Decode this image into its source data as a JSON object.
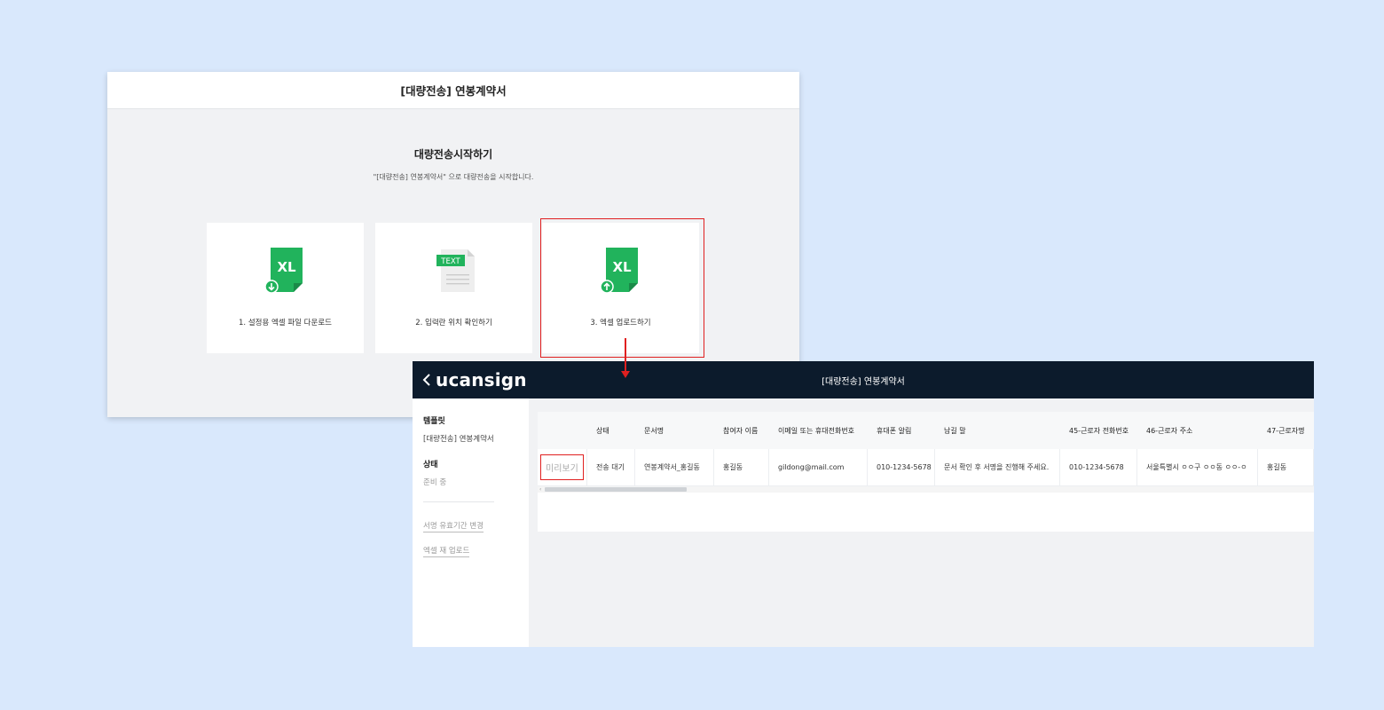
{
  "window1": {
    "title": "[대량전송] 연봉계약서",
    "heading": "대량전송시작하기",
    "subtitle": "\"[대량전송] 연봉계약서\" 으로 대량전송을 시작합니다.",
    "cards": [
      {
        "label": "1. 설정용 엑셀 파일 다운로드",
        "icon": "excel-download-icon",
        "badge": "XL"
      },
      {
        "label": "2. 입력란 위치 확인하기",
        "icon": "text-file-icon",
        "badge": "TEXT"
      },
      {
        "label": "3. 엑셀 업로드하기",
        "icon": "excel-upload-icon",
        "badge": "XL"
      }
    ]
  },
  "window2": {
    "logo": "ucansign",
    "title": "[대량전송] 연봉계약서",
    "sidebar": {
      "template_label": "템플릿",
      "template_value": "[대량전송] 연봉계약서",
      "status_label": "상태",
      "status_value": "준비 중",
      "links": [
        "서명 유효기간 변경",
        "엑셀 재 업로드"
      ]
    },
    "table": {
      "columns": [
        "",
        "상태",
        "문서명",
        "참여자 이름",
        "이메일 또는 휴대전화번호",
        "휴대폰 알림",
        "남길 말",
        "45-근로자 전화번호",
        "46-근로자 주소",
        "47-근로자명"
      ],
      "rows": [
        {
          "preview": "미리보기",
          "cells": [
            "전송 대기",
            "연봉계약서_홍길동",
            "홍길동",
            "gildong@mail.com",
            "010-1234-5678",
            "문서 확인 후 서명을 진행해 주세요.",
            "010-1234-5678",
            "서울특별시 ㅇㅇ구 ㅇㅇ동 ㅇㅇ-ㅇ",
            "홍길동"
          ]
        }
      ]
    }
  },
  "colors": {
    "background": "#d9e8fc",
    "highlight": "#e02020",
    "topbar": "#0c1b2c",
    "excel_green": "#21b35c"
  }
}
